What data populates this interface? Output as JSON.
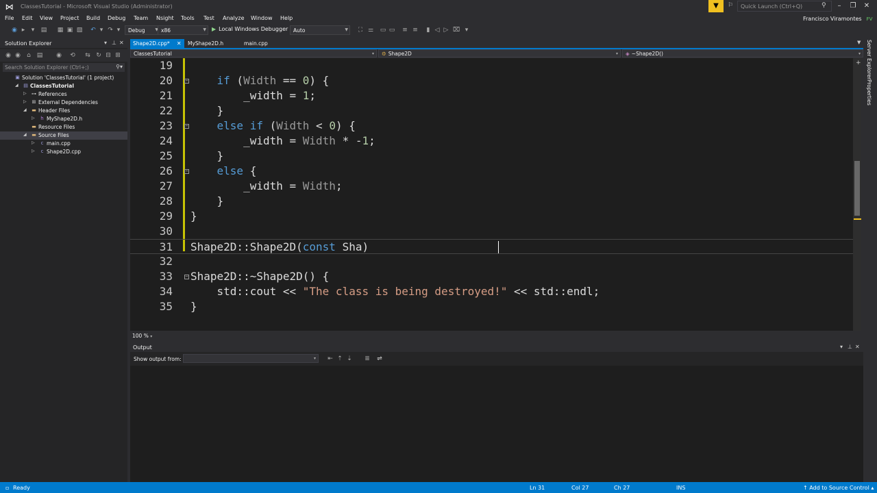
{
  "window": {
    "title": "ClassesTutorial - Microsoft Visual Studio (Administrator)",
    "quick_launch_placeholder": "Quick Launch (Ctrl+Q)",
    "user_name": "Francisco Viramontes",
    "user_initials": "FV"
  },
  "menu": [
    "File",
    "Edit",
    "View",
    "Project",
    "Build",
    "Debug",
    "Team",
    "Nsight",
    "Tools",
    "Test",
    "Analyze",
    "Window",
    "Help"
  ],
  "toolbar": {
    "configuration": "Debug",
    "platform": "x86",
    "debugger": "Local Windows Debugger",
    "debugger_mode": "Auto"
  },
  "solution_explorer": {
    "title": "Solution Explorer",
    "search_placeholder": "Search Solution Explorer (Ctrl+;)",
    "tree": [
      {
        "label": "Solution 'ClassesTutorial' (1 project)",
        "indent": 0,
        "expander": "",
        "icon": "solution-icon"
      },
      {
        "label": "ClassesTutorial",
        "indent": 1,
        "expander": "◢",
        "icon": "project-icon"
      },
      {
        "label": "References",
        "indent": 2,
        "expander": "▷",
        "icon": "references-icon"
      },
      {
        "label": "External Dependencies",
        "indent": 2,
        "expander": "▷",
        "icon": "external-dependencies-icon"
      },
      {
        "label": "Header Files",
        "indent": 2,
        "expander": "◢",
        "icon": "folder-icon"
      },
      {
        "label": "MyShape2D.h",
        "indent": 3,
        "expander": "▷",
        "icon": "header-file-icon"
      },
      {
        "label": "Resource Files",
        "indent": 2,
        "expander": "",
        "icon": "folder-icon"
      },
      {
        "label": "Source Files",
        "indent": 2,
        "expander": "◢",
        "icon": "folder-icon",
        "selected": true
      },
      {
        "label": "main.cpp",
        "indent": 3,
        "expander": "▷",
        "icon": "cpp-file-icon"
      },
      {
        "label": "Shape2D.cpp",
        "indent": 3,
        "expander": "▷",
        "icon": "cpp-file-icon"
      }
    ]
  },
  "tabs": [
    {
      "label": "Shape2D.cpp*",
      "active": true
    },
    {
      "label": "MyShape2D.h",
      "active": false
    },
    {
      "label": "main.cpp",
      "active": false
    }
  ],
  "navbar": {
    "project": "ClassesTutorial",
    "scope": "Shape2D",
    "member": "~Shape2D()"
  },
  "code": {
    "current_line": 31,
    "lines": [
      {
        "n": "19",
        "tokens": []
      },
      {
        "n": "20",
        "tokens": [
          [
            "    ",
            "id"
          ],
          [
            "if",
            "kw"
          ],
          [
            " (",
            "id"
          ],
          [
            "Width",
            "param"
          ],
          [
            " == ",
            "id"
          ],
          [
            "0",
            "num"
          ],
          [
            ") {",
            "id"
          ]
        ]
      },
      {
        "n": "21",
        "tokens": [
          [
            "        _width = ",
            "id"
          ],
          [
            "1",
            "num"
          ],
          [
            ";",
            "id"
          ]
        ]
      },
      {
        "n": "22",
        "tokens": [
          [
            "    }",
            "id"
          ]
        ]
      },
      {
        "n": "23",
        "tokens": [
          [
            "    ",
            "id"
          ],
          [
            "else",
            "kw"
          ],
          [
            " ",
            "id"
          ],
          [
            "if",
            "kw"
          ],
          [
            " (",
            "id"
          ],
          [
            "Width",
            "param"
          ],
          [
            " < ",
            "id"
          ],
          [
            "0",
            "num"
          ],
          [
            ") {",
            "id"
          ]
        ]
      },
      {
        "n": "24",
        "tokens": [
          [
            "        _width = ",
            "id"
          ],
          [
            "Width",
            "param"
          ],
          [
            " * -",
            "id"
          ],
          [
            "1",
            "num"
          ],
          [
            ";",
            "id"
          ]
        ]
      },
      {
        "n": "25",
        "tokens": [
          [
            "    }",
            "id"
          ]
        ]
      },
      {
        "n": "26",
        "tokens": [
          [
            "    ",
            "id"
          ],
          [
            "else",
            "kw"
          ],
          [
            " {",
            "id"
          ]
        ]
      },
      {
        "n": "27",
        "tokens": [
          [
            "        _width = ",
            "id"
          ],
          [
            "Width",
            "param"
          ],
          [
            ";",
            "id"
          ]
        ]
      },
      {
        "n": "28",
        "tokens": [
          [
            "    }",
            "id"
          ]
        ]
      },
      {
        "n": "29",
        "tokens": [
          [
            "}",
            "id"
          ]
        ]
      },
      {
        "n": "30",
        "tokens": []
      },
      {
        "n": "31",
        "tokens": [
          [
            "Shape2D::Shape2D(",
            "id"
          ],
          [
            "const",
            "kw"
          ],
          [
            " Sha)",
            "id"
          ]
        ]
      },
      {
        "n": "32",
        "tokens": []
      },
      {
        "n": "33",
        "tokens": [
          [
            "Shape2D::~Shape2D() {",
            "id"
          ]
        ]
      },
      {
        "n": "34",
        "tokens": [
          [
            "    std::cout << ",
            "id"
          ],
          [
            "\"The class is being destroyed!\"",
            "str"
          ],
          [
            " << std::endl;",
            "id"
          ]
        ]
      },
      {
        "n": "35",
        "tokens": [
          [
            "}",
            "id"
          ]
        ]
      }
    ]
  },
  "zoom": "100 %",
  "output": {
    "title": "Output",
    "source_label": "Show output from:",
    "source_value": ""
  },
  "right_tabs": [
    "Server Explorer",
    "Properties"
  ],
  "status": {
    "state": "Ready",
    "line": "Ln 31",
    "col": "Col 27",
    "ch": "Ch 27",
    "mode": "INS",
    "source_control": "Add to Source Control"
  },
  "colors": {
    "accent": "#007acc",
    "keyword": "#569cd6",
    "string": "#d69d85",
    "change_marker": "#e5e000"
  }
}
